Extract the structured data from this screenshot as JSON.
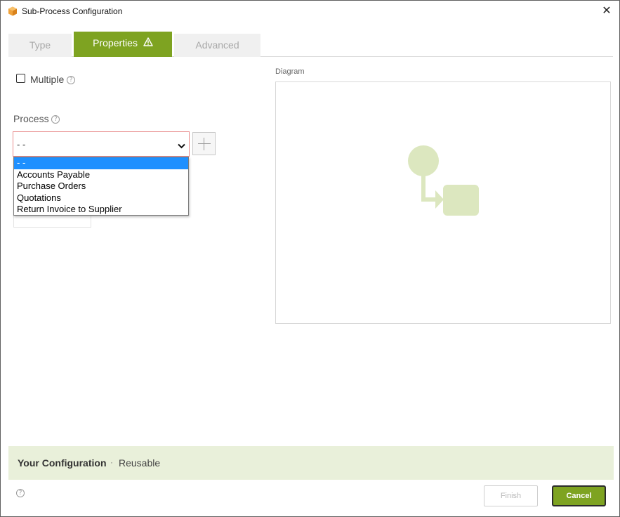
{
  "window": {
    "title": "Sub-Process Configuration",
    "close_label": "✕"
  },
  "tabs": [
    {
      "label": "Type",
      "active": false
    },
    {
      "label": "Properties",
      "active": true,
      "has_warning": true
    },
    {
      "label": "Advanced",
      "active": false
    }
  ],
  "form": {
    "multiple_label": "Multiple",
    "multiple_checked": false,
    "process_label": "Process",
    "process_value": "- -",
    "dropdown_options": [
      "- -",
      "Accounts Payable",
      "Purchase Orders",
      "Quotations",
      "Return Invoice to Supplier"
    ],
    "dropdown_selected_index": 0
  },
  "diagram": {
    "label": "Diagram"
  },
  "config": {
    "title": "Your Configuration",
    "separator": "·",
    "value": "Reusable"
  },
  "buttons": {
    "finish": "Finish",
    "cancel": "Cancel"
  },
  "icons": {
    "app": "cube-icon",
    "warning": "warning-icon",
    "help": "help-icon",
    "close": "close-icon",
    "chevron": "chevron-down-icon",
    "add": "plus-icon"
  },
  "colors": {
    "accent": "#7ea321",
    "config_bg": "#e9f0da",
    "diagram_shape": "#dce7bf",
    "selection": "#1e90ff",
    "invalid_border": "#e88c8c"
  }
}
